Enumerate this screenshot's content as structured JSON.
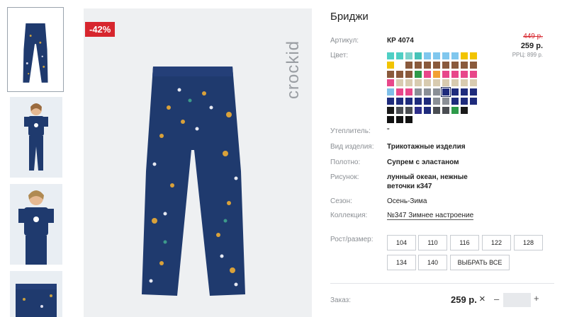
{
  "product": {
    "title": "Бриджи",
    "discount_badge": "-42%",
    "brand": "crockid",
    "article_label": "Артикул:",
    "article_value": "КР 4074",
    "color_label": "Цвет:",
    "price_old": "449 р.",
    "price_new": "259 р.",
    "price_rrp": "РРЦ: 899 р."
  },
  "attributes": [
    {
      "label": "Утеплитель:",
      "value": "\"",
      "bold": false
    },
    {
      "label": "Вид изделия:",
      "value": "Трикотажные изделия",
      "bold": true
    },
    {
      "label": "Полотно:",
      "value": "Супрем с эластаном",
      "bold": true
    },
    {
      "label": "Рисунок:",
      "value_line1": "лунный океан, нежные",
      "value_line2": "веточки к347",
      "bold": true
    },
    {
      "label": "Сезон:",
      "value": "Осень-Зима",
      "bold": false
    },
    {
      "label": "Коллекция:",
      "value": "№347 Зимнее настроение",
      "bold": false,
      "link": true
    }
  ],
  "sizes": {
    "label": "Рост/размер:",
    "options": [
      "104",
      "110",
      "116",
      "122",
      "128",
      "134",
      "140"
    ],
    "select_all": "ВЫБРАТЬ ВСЕ"
  },
  "order": {
    "label": "Заказ:",
    "price": "259 р.",
    "remove": "×",
    "minus": "–",
    "plus": "+",
    "quantity": ""
  },
  "swatch_colors": [
    [
      "#4fcfc4",
      "#4fcfc4",
      "#7ad3cc",
      "#46c3b8",
      "#80c7ee",
      "#80c7ee",
      "#80c7ee",
      "#80c7ee",
      "#f2c400",
      "#f2c400"
    ],
    [
      "#f2c400",
      "#ffffff",
      "#8a5a3c",
      "#8a5a3c",
      "#8a5a3c",
      "#8a5a3c",
      "#8a5a3c",
      "#8a5a3c",
      "#8a5a3c",
      "#8a5a3c"
    ],
    [
      "#8a5a3c",
      "#8a5a3c",
      "#8a5a3c",
      "#2e9a4a",
      "#e8478a",
      "#f2a033",
      "#e8478a",
      "#e8478a",
      "#e8478a",
      "#e8478a"
    ],
    [
      "#e8478a",
      "#d8cbb0",
      "#d8cbb0",
      "#d8cbb0",
      "#d8cbb0",
      "#d8cbb0",
      "#d8cbb0",
      "#d8cbb0",
      "#d8cbb0",
      "#d8cbb0"
    ],
    [
      "#7fbfe8",
      "#e8478a",
      "#e8478a",
      "#8a8f96",
      "#8a8f96",
      "#8a8f96",
      "#1e2b7c",
      "#1e2b7c",
      "#1e2b7c",
      "#1e2b7c"
    ],
    [
      "#1e2b7c",
      "#1e2b7c",
      "#1e2b7c",
      "#1e2b7c",
      "#1e2b7c",
      "#8a8f96",
      "#8a8f96",
      "#1e2b7c",
      "#1e2b7c",
      "#1e2b7c"
    ],
    [
      "#1a1a1a",
      "#4a4d52",
      "#4a4d52",
      "#2e2e8a",
      "#1e2b7c",
      "#4a4d52",
      "#4a4d52",
      "#2e9a4a",
      "#1a1a1a",
      "#ffffff"
    ],
    [
      "#111111",
      "#111111",
      "#111111",
      "#ffffff",
      "#ffffff",
      "#ffffff",
      "#ffffff",
      "#ffffff",
      "#ffffff",
      "#ffffff"
    ]
  ],
  "selected_swatch": "row 5, column 7"
}
